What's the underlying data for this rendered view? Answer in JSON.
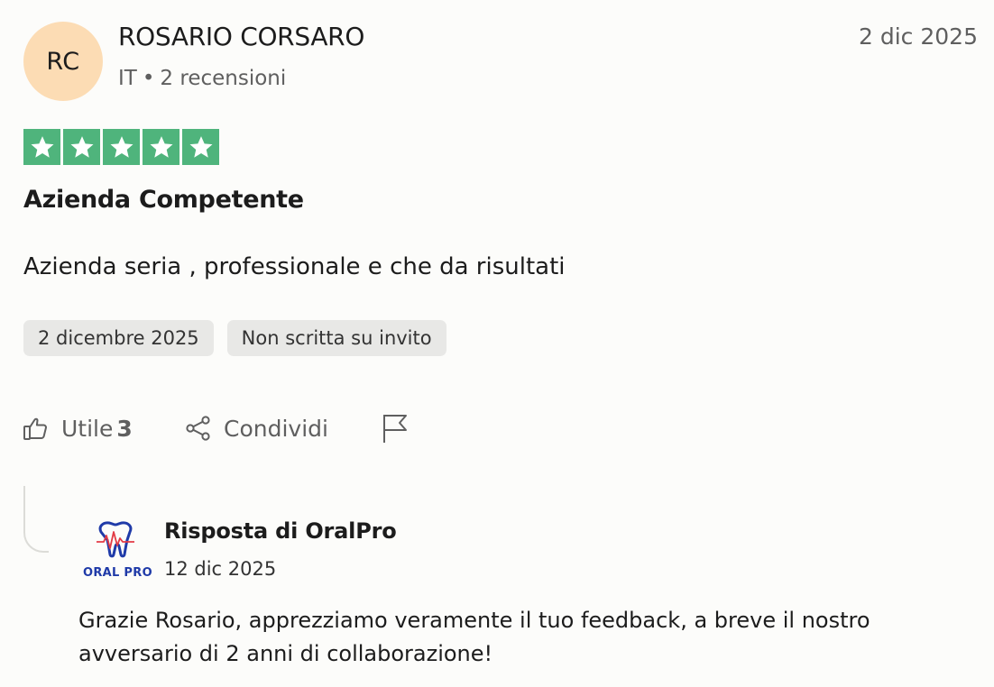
{
  "reviewer": {
    "initials": "RC",
    "name": "ROSARIO CORSARO",
    "country": "IT",
    "separator": "•",
    "reviews_count": "2 recensioni",
    "avatar_color": "#fcdcb4"
  },
  "review": {
    "date": "2 dic 2025",
    "rating": 5,
    "rating_max": 5,
    "star_color": "#4fb47c",
    "title": "Azienda Competente",
    "body": "Azienda seria , professionale e che da risultati",
    "tags": [
      "2 dicembre 2025",
      "Non scritta su invito"
    ]
  },
  "actions": {
    "useful_label": "Utile",
    "useful_count": "3",
    "share_label": "Condividi",
    "useful_icon": "thumbs-up-icon",
    "share_icon": "share-icon",
    "flag_icon": "flag-icon"
  },
  "reply": {
    "title": "Risposta di OralPro",
    "date": "12 dic 2025",
    "logo_text": "ORAL PRO",
    "body": "Grazie Rosario, apprezziamo veramente il tuo feedback, a breve il nostro avversario di 2 anni di collaborazione!"
  }
}
